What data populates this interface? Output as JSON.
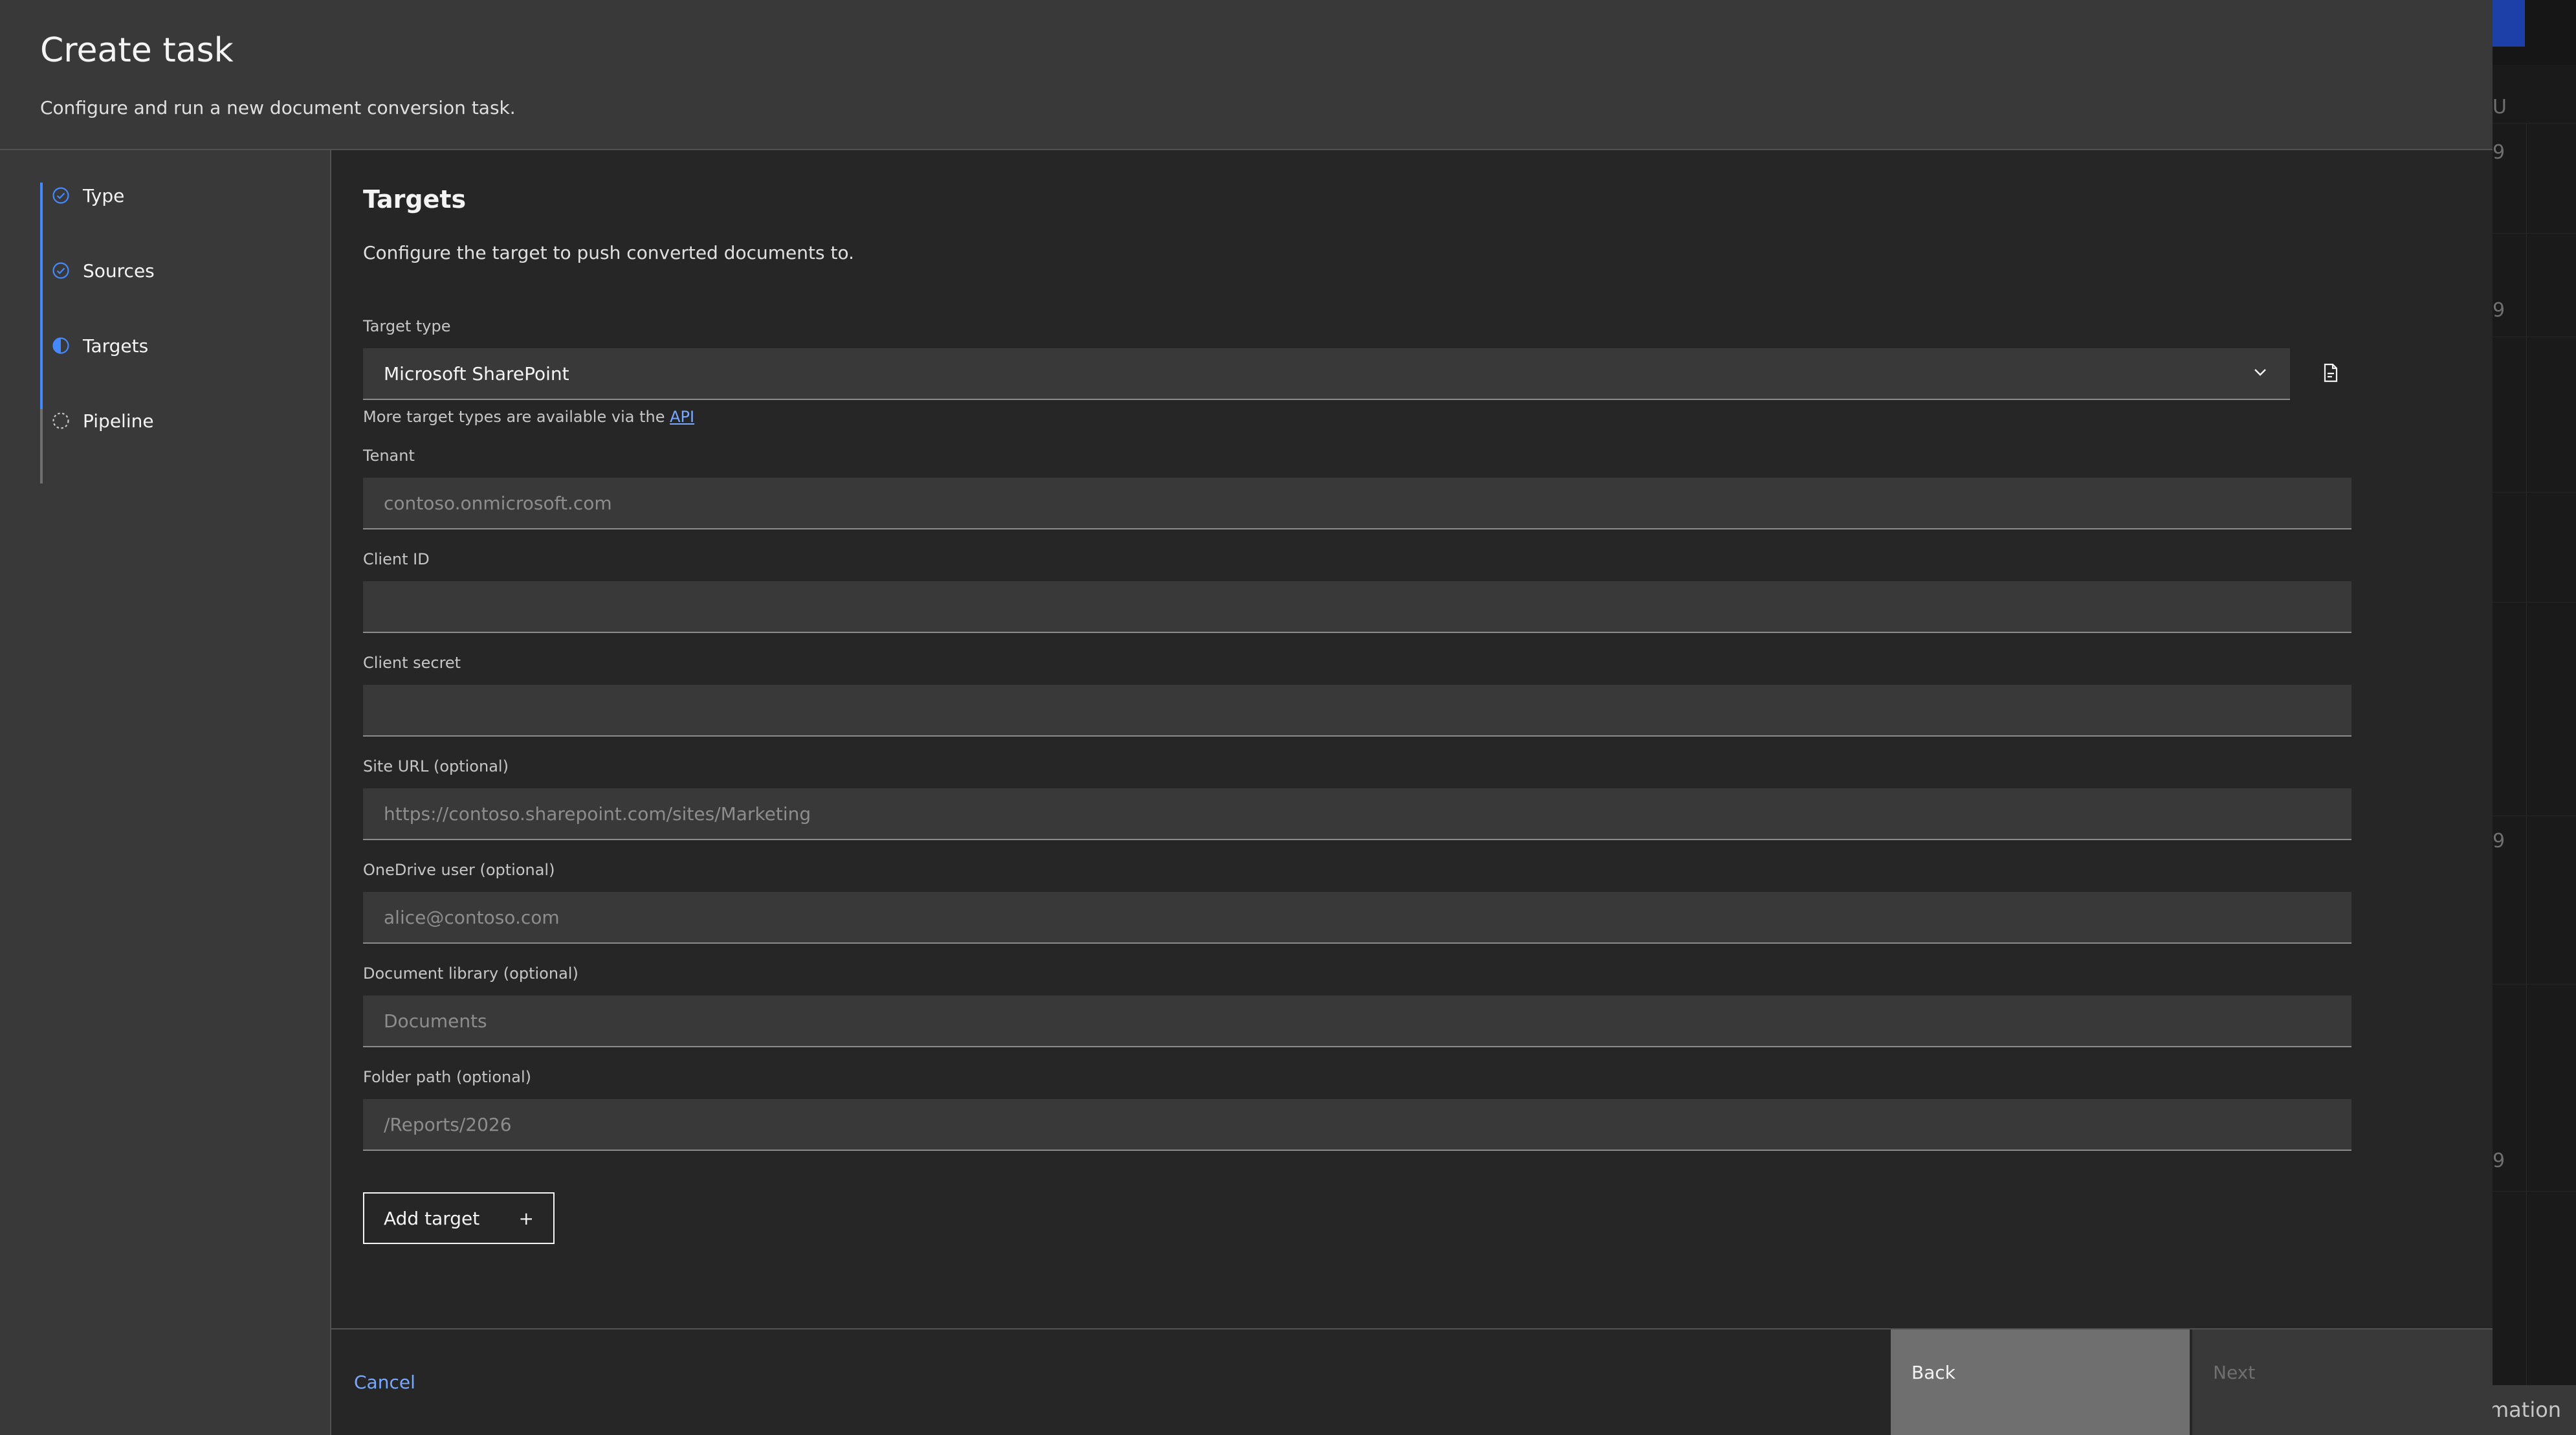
{
  "background_app": {
    "column_letters": [
      "U",
      "9",
      "9",
      "9",
      "9"
    ],
    "bottom_text": "mation"
  },
  "modal": {
    "title": "Create task",
    "subtitle": "Configure and run a new document conversion task."
  },
  "steps": [
    {
      "label": "Type",
      "status": "complete",
      "icon": "checkmark-outline-icon"
    },
    {
      "label": "Sources",
      "status": "complete",
      "icon": "checkmark-outline-icon"
    },
    {
      "label": "Targets",
      "status": "current",
      "icon": "incomplete-half-icon"
    },
    {
      "label": "Pipeline",
      "status": "not-started",
      "icon": "circle-dash-icon"
    }
  ],
  "section": {
    "title": "Targets",
    "description": "Configure the target to push converted documents to."
  },
  "target_type": {
    "label": "Target type",
    "value": "Microsoft SharePoint",
    "helper_prefix": "More target types are available via the",
    "helper_link": "API"
  },
  "fields": {
    "tenant": {
      "label": "Tenant",
      "placeholder": "contoso.onmicrosoft.com",
      "value": ""
    },
    "client_id": {
      "label": "Client ID",
      "placeholder": "",
      "value": ""
    },
    "client_secret": {
      "label": "Client secret",
      "placeholder": "",
      "value": ""
    },
    "site_url": {
      "label": "Site URL (optional)",
      "placeholder": "https://contoso.sharepoint.com/sites/Marketing",
      "value": ""
    },
    "onedrive_user": {
      "label": "OneDrive user (optional)",
      "placeholder": "alice@contoso.com",
      "value": ""
    },
    "document_library": {
      "label": "Document library (optional)",
      "placeholder": "Documents",
      "value": ""
    },
    "folder_path": {
      "label": "Folder path (optional)",
      "placeholder": "/Reports/2026",
      "value": ""
    }
  },
  "add_target": {
    "label": "Add target",
    "icon": "+"
  },
  "footer": {
    "cancel_label": "Cancel",
    "back_label": "Back",
    "next_label": "Next"
  },
  "colors": {
    "accent": "#4589ff",
    "link": "#78a9ff",
    "modal_bg": "#262626",
    "header_bg": "#393939",
    "field_bg": "#393939",
    "back_button_bg": "#6f6f6f"
  }
}
